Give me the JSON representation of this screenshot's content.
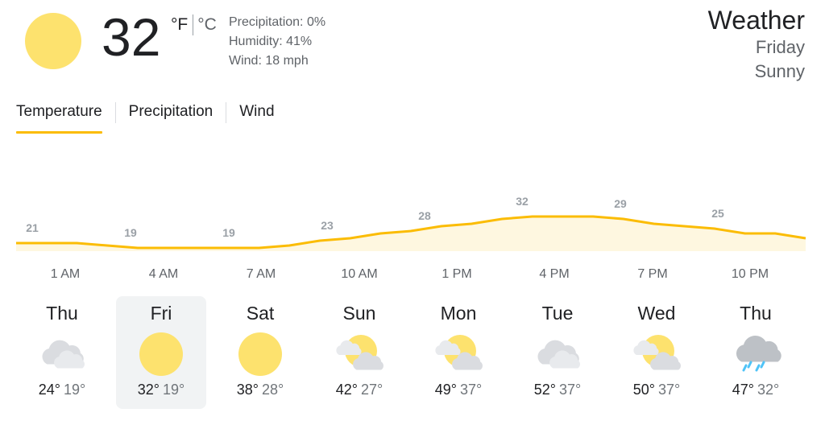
{
  "current": {
    "temperature": "32",
    "unit_f": "°F",
    "unit_c": "°C",
    "precipitation": "Precipitation: 0%",
    "humidity": "Humidity: 41%",
    "wind": "Wind: 18 mph",
    "icon": "sun-icon"
  },
  "location": {
    "title": "Weather",
    "day": "Friday",
    "condition": "Sunny"
  },
  "tabs": [
    {
      "label": "Temperature",
      "active": true
    },
    {
      "label": "Precipitation",
      "active": false
    },
    {
      "label": "Wind",
      "active": false
    }
  ],
  "hourly": {
    "labels": [
      "21",
      "19",
      "19",
      "23",
      "28",
      "32",
      "29",
      "25"
    ],
    "times": [
      "1 AM",
      "4 AM",
      "7 AM",
      "10 AM",
      "1 PM",
      "4 PM",
      "7 PM",
      "10 PM"
    ],
    "series": [
      21,
      21,
      21,
      20,
      19,
      19,
      19,
      19,
      19,
      20,
      22,
      23,
      25,
      26,
      28,
      29,
      31,
      32,
      32,
      32,
      31,
      29,
      28,
      27,
      25,
      25,
      23
    ],
    "line_color": "#fbbc04",
    "fill_color": "#fef7e0"
  },
  "days": [
    {
      "name": "Thu",
      "high": "24°",
      "low": "19°",
      "icon": "cloudy-icon",
      "selected": false
    },
    {
      "name": "Fri",
      "high": "32°",
      "low": "19°",
      "icon": "sunny-icon",
      "selected": true
    },
    {
      "name": "Sat",
      "high": "38°",
      "low": "28°",
      "icon": "sunny-icon",
      "selected": false
    },
    {
      "name": "Sun",
      "high": "42°",
      "low": "27°",
      "icon": "partly-cloudy-icon",
      "selected": false
    },
    {
      "name": "Mon",
      "high": "49°",
      "low": "37°",
      "icon": "partly-cloudy-icon",
      "selected": false
    },
    {
      "name": "Tue",
      "high": "52°",
      "low": "37°",
      "icon": "cloudy-icon",
      "selected": false
    },
    {
      "name": "Wed",
      "high": "50°",
      "low": "37°",
      "icon": "partly-cloudy-icon",
      "selected": false
    },
    {
      "name": "Thu",
      "high": "47°",
      "low": "32°",
      "icon": "rain-icon",
      "selected": false
    }
  ]
}
